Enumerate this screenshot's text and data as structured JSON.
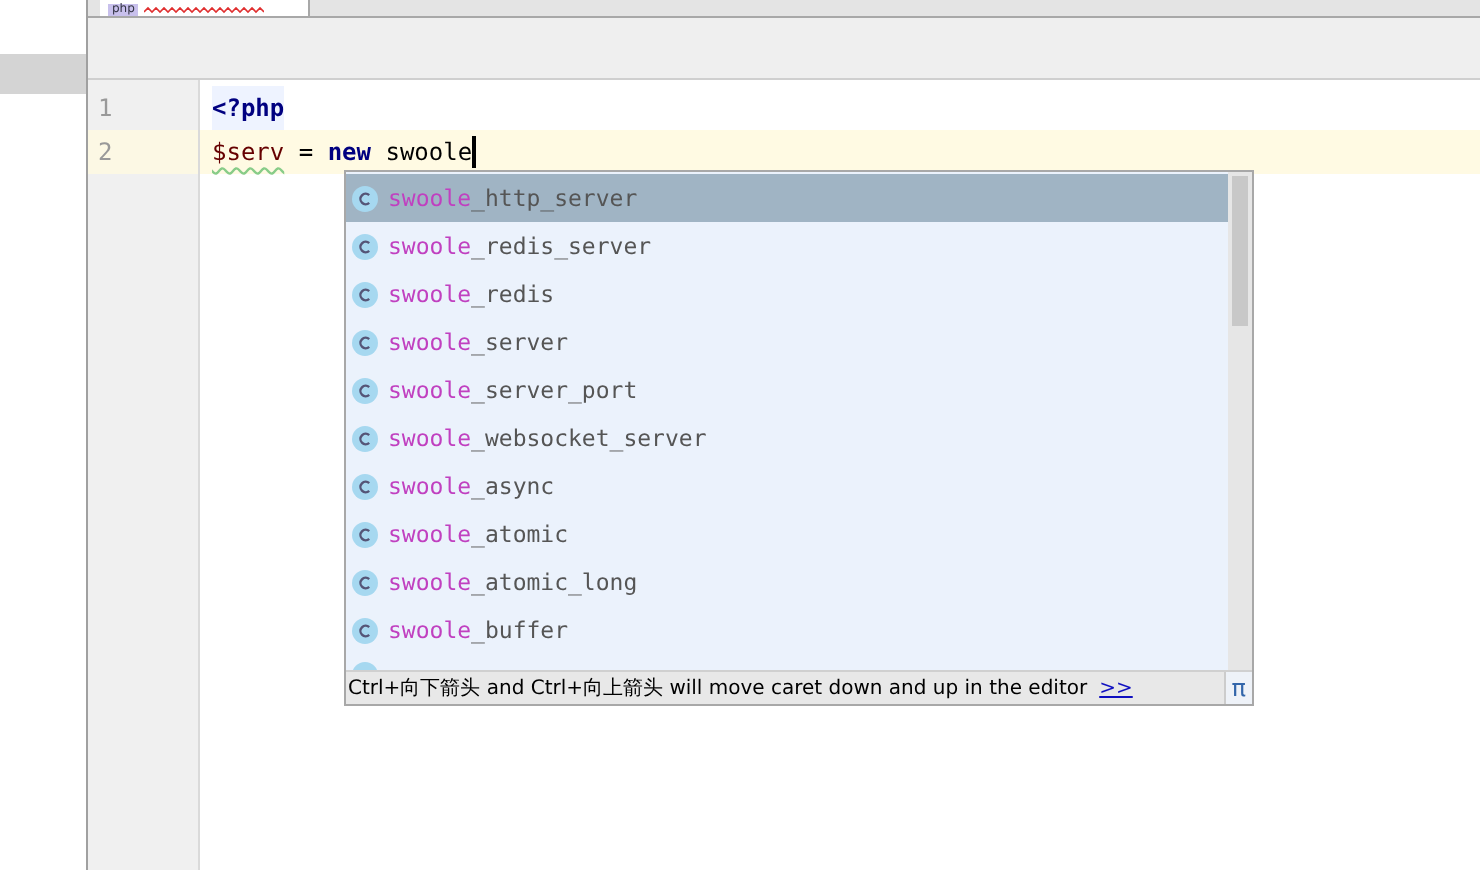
{
  "tab": {
    "badge": "php",
    "selected": true
  },
  "editor": {
    "lines": [
      {
        "number": "1",
        "current": false,
        "tokens": [
          {
            "kind": "tag",
            "text": "<?php"
          }
        ]
      },
      {
        "number": "2",
        "current": true,
        "tokens": [
          {
            "kind": "variable",
            "text": "$serv"
          },
          {
            "kind": "plain",
            "text": " = "
          },
          {
            "kind": "keyword",
            "text": "new"
          },
          {
            "kind": "plain",
            "text": " swoole"
          }
        ]
      }
    ]
  },
  "completion": {
    "items": [
      {
        "match": "swoole",
        "rest": "_http_server",
        "selected": true
      },
      {
        "match": "swoole",
        "rest": "_redis_server",
        "selected": false
      },
      {
        "match": "swoole",
        "rest": "_redis",
        "selected": false
      },
      {
        "match": "swoole",
        "rest": "_server",
        "selected": false
      },
      {
        "match": "swoole",
        "rest": "_server_port",
        "selected": false
      },
      {
        "match": "swoole",
        "rest": "_websocket_server",
        "selected": false
      },
      {
        "match": "swoole",
        "rest": "_async",
        "selected": false
      },
      {
        "match": "swoole",
        "rest": "_atomic",
        "selected": false
      },
      {
        "match": "swoole",
        "rest": "_atomic_long",
        "selected": false
      },
      {
        "match": "swoole",
        "rest": "_buffer",
        "selected": false
      }
    ],
    "hint": "Ctrl+向下箭头 and Ctrl+向上箭头 will move caret down and up in the editor",
    "hint_link": ">>",
    "pi": "π"
  }
}
